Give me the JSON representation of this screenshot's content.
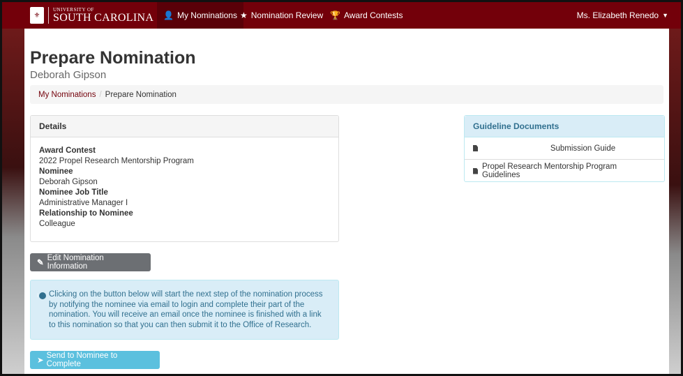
{
  "navbar": {
    "brand_small": "UNIVERSITY OF",
    "brand_big": "SOUTH CAROLINA",
    "items": [
      {
        "label": "My Nominations",
        "icon": "user-icon"
      },
      {
        "label": "Nomination Review",
        "icon": "star-icon"
      },
      {
        "label": "Award Contests",
        "icon": "trophy-icon"
      }
    ],
    "user": "Ms. Elizabeth Renedo",
    "colors": {
      "primary": "#73000a"
    }
  },
  "page": {
    "title": "Prepare Nomination",
    "subtitle": "Deborah Gipson"
  },
  "breadcrumb": {
    "link": "My Nominations",
    "separator": "/",
    "current": "Prepare Nomination"
  },
  "details": {
    "heading": "Details",
    "fields": [
      {
        "label": "Award Contest",
        "value": "2022 Propel Research Mentorship Program"
      },
      {
        "label": "Nominee",
        "value": "Deborah Gipson"
      },
      {
        "label": "Nominee Job Title",
        "value": "Administrative Manager I"
      },
      {
        "label": "Relationship to Nominee",
        "value": "Colleague"
      }
    ]
  },
  "buttons": {
    "edit": "Edit Nomination Information",
    "send": "Send to Nominee to Complete"
  },
  "alert": {
    "text": "Clicking on the button below will start the next step of the nomination process by notifying the nominee via email to login and complete their part of the nomination. You will receive an email once the nominee is finished with a link to this nomination so that you can then submit it to the Office of Research."
  },
  "guidelines": {
    "heading": "Guideline Documents",
    "docs": [
      "Submission Guide",
      "Propel Research Mentorship Program Guidelines"
    ]
  }
}
